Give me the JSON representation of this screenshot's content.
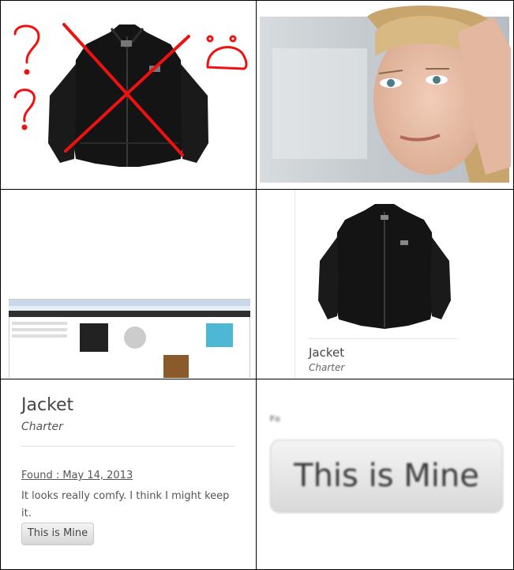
{
  "panels": {
    "card": {
      "title": "Jacket",
      "subtitle": "Charter"
    },
    "detail": {
      "title": "Jacket",
      "subtitle": "Charter",
      "found_label": "Found : May 14, 2013",
      "description": "It looks really comfy. I think I might keep it.",
      "button_label": "This is Mine"
    },
    "zoom": {
      "partial_text": "Fo",
      "button_label": "This is Mine"
    }
  },
  "colors": {
    "scribble": "#ff0000",
    "jacket": "#141414",
    "border": "#000000"
  }
}
